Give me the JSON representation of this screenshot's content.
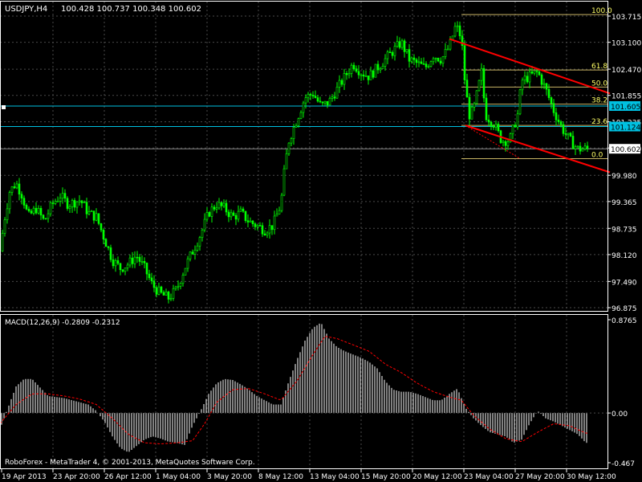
{
  "window": {
    "symbol_label": "USDJPY,H4",
    "ohlc_label": "100.428 100.737 100.348 100.602",
    "copyright": "RoboForex - MetaTrader 4, © 2001-2013, MetaQuotes Software Corp."
  },
  "colors": {
    "background": "#000000",
    "candle_bull": "#00ff00",
    "grid": "#4a4a4a",
    "axis": "#ffffff",
    "fib": "#c8b464",
    "channel": "#ff0000",
    "hline_cyan": "#00c0e0",
    "macd_hist": "#ffffff",
    "macd_signal": "#ff0000"
  },
  "price_axis": {
    "ticks": [
      "103.715",
      "103.100",
      "102.470",
      "101.855",
      "101.235",
      "100.620",
      "99.980",
      "99.365",
      "98.735",
      "98.120",
      "97.490",
      "96.875"
    ],
    "range": [
      96.875,
      103.715
    ]
  },
  "time_axis": {
    "labels": [
      "19 Apr 2013",
      "23 Apr 20:00",
      "26 Apr 12:00",
      "1 May 04:00",
      "3 May 20:00",
      "8 May 12:00",
      "13 May 04:00",
      "15 May 20:00",
      "20 May 12:00",
      "23 May 04:00",
      "27 May 20:00",
      "30 May 12:00"
    ]
  },
  "price_labels": {
    "hline_upper": "101.605",
    "hline_lower": "101.124",
    "current": "100.602"
  },
  "fibonacci": {
    "levels": [
      {
        "label": "100.0",
        "price": 103.75
      },
      {
        "label": "61.8",
        "price": 102.45
      },
      {
        "label": "50.0",
        "price": 102.05
      },
      {
        "label": "38.2",
        "price": 101.65
      },
      {
        "label": "23.6",
        "price": 101.15
      },
      {
        "label": "0.0",
        "price": 100.37
      }
    ]
  },
  "chart_data": {
    "type": "candlestick",
    "title": "USDJPY,H4",
    "price_range": [
      96.875,
      103.715
    ],
    "close_path": [
      [
        0,
        98.2
      ],
      [
        5,
        98.9
      ],
      [
        12,
        99.6
      ],
      [
        20,
        99.8
      ],
      [
        28,
        99.5
      ],
      [
        35,
        99.0
      ],
      [
        45,
        99.2
      ],
      [
        55,
        98.9
      ],
      [
        65,
        99.3
      ],
      [
        75,
        99.5
      ],
      [
        85,
        99.3
      ],
      [
        100,
        99.4
      ],
      [
        110,
        99.1
      ],
      [
        120,
        99.0
      ],
      [
        130,
        98.5
      ],
      [
        140,
        98.0
      ],
      [
        150,
        97.8
      ],
      [
        160,
        97.9
      ],
      [
        170,
        98.1
      ],
      [
        180,
        97.8
      ],
      [
        190,
        97.4
      ],
      [
        200,
        97.2
      ],
      [
        210,
        97.1
      ],
      [
        220,
        97.3
      ],
      [
        230,
        97.8
      ],
      [
        240,
        98.2
      ],
      [
        250,
        98.6
      ],
      [
        260,
        99.1
      ],
      [
        270,
        99.3
      ],
      [
        280,
        99.2
      ],
      [
        290,
        99.0
      ],
      [
        300,
        99.1
      ],
      [
        310,
        98.9
      ],
      [
        320,
        98.8
      ],
      [
        330,
        98.7
      ],
      [
        340,
        98.8
      ],
      [
        350,
        99.3
      ],
      [
        355,
        100.2
      ],
      [
        360,
        100.8
      ],
      [
        370,
        101.3
      ],
      [
        380,
        101.8
      ],
      [
        390,
        101.9
      ],
      [
        400,
        101.6
      ],
      [
        410,
        101.7
      ],
      [
        420,
        102.0
      ],
      [
        430,
        102.3
      ],
      [
        440,
        102.6
      ],
      [
        450,
        102.4
      ],
      [
        460,
        102.3
      ],
      [
        470,
        102.5
      ],
      [
        480,
        102.7
      ],
      [
        490,
        102.9
      ],
      [
        500,
        103.1
      ],
      [
        510,
        102.7
      ],
      [
        520,
        102.6
      ],
      [
        530,
        102.5
      ],
      [
        540,
        102.8
      ],
      [
        550,
        102.7
      ],
      [
        560,
        103.0
      ],
      [
        568,
        103.5
      ],
      [
        575,
        103.2
      ],
      [
        580,
        102.0
      ],
      [
        585,
        101.4
      ],
      [
        590,
        101.5
      ],
      [
        600,
        102.4
      ],
      [
        605,
        101.4
      ],
      [
        615,
        101.2
      ],
      [
        625,
        100.8
      ],
      [
        635,
        100.8
      ],
      [
        645,
        101.4
      ],
      [
        650,
        102.2
      ],
      [
        660,
        102.3
      ],
      [
        670,
        102.4
      ],
      [
        680,
        102.0
      ],
      [
        690,
        101.5
      ],
      [
        700,
        101.1
      ],
      [
        710,
        100.8
      ],
      [
        720,
        100.6
      ],
      [
        730,
        100.6
      ]
    ],
    "trend_lines": [
      {
        "from": [
          560,
          103.18
        ],
        "to": [
          760,
          101.9
        ]
      },
      {
        "from": [
          580,
          101.15
        ],
        "to": [
          760,
          100.05
        ]
      }
    ],
    "horizontal_lines": [
      101.605,
      101.124,
      100.602
    ],
    "macd": {
      "label": "MACD(12,26,9) -0.2809 -0.2312",
      "ticks": [
        "0.8765",
        "0.00",
        "-0.467"
      ],
      "range": [
        -0.467,
        0.8765
      ],
      "hist_path": [
        [
          0,
          -0.15
        ],
        [
          10,
          0.05
        ],
        [
          20,
          0.25
        ],
        [
          30,
          0.32
        ],
        [
          40,
          0.32
        ],
        [
          50,
          0.24
        ],
        [
          60,
          0.16
        ],
        [
          70,
          0.15
        ],
        [
          80,
          0.14
        ],
        [
          90,
          0.12
        ],
        [
          100,
          0.1
        ],
        [
          110,
          0.08
        ],
        [
          120,
          0.02
        ],
        [
          130,
          -0.08
        ],
        [
          140,
          -0.22
        ],
        [
          150,
          -0.33
        ],
        [
          160,
          -0.37
        ],
        [
          170,
          -0.31
        ],
        [
          180,
          -0.25
        ],
        [
          190,
          -0.22
        ],
        [
          200,
          -0.24
        ],
        [
          210,
          -0.27
        ],
        [
          220,
          -0.28
        ],
        [
          230,
          -0.3
        ],
        [
          240,
          -0.12
        ],
        [
          250,
          0.02
        ],
        [
          260,
          0.18
        ],
        [
          270,
          0.28
        ],
        [
          280,
          0.32
        ],
        [
          290,
          0.31
        ],
        [
          300,
          0.27
        ],
        [
          310,
          0.22
        ],
        [
          320,
          0.16
        ],
        [
          330,
          0.12
        ],
        [
          340,
          0.08
        ],
        [
          350,
          0.08
        ],
        [
          360,
          0.3
        ],
        [
          370,
          0.5
        ],
        [
          380,
          0.68
        ],
        [
          390,
          0.8
        ],
        [
          400,
          0.85
        ],
        [
          410,
          0.7
        ],
        [
          420,
          0.62
        ],
        [
          430,
          0.58
        ],
        [
          440,
          0.55
        ],
        [
          450,
          0.52
        ],
        [
          460,
          0.48
        ],
        [
          470,
          0.42
        ],
        [
          480,
          0.3
        ],
        [
          490,
          0.22
        ],
        [
          500,
          0.2
        ],
        [
          510,
          0.2
        ],
        [
          520,
          0.18
        ],
        [
          530,
          0.15
        ],
        [
          540,
          0.12
        ],
        [
          550,
          0.12
        ],
        [
          560,
          0.18
        ],
        [
          570,
          0.23
        ],
        [
          580,
          0.05
        ],
        [
          590,
          -0.05
        ],
        [
          600,
          -0.12
        ],
        [
          610,
          -0.18
        ],
        [
          620,
          -0.2
        ],
        [
          630,
          -0.22
        ],
        [
          640,
          -0.28
        ],
        [
          650,
          -0.25
        ],
        [
          660,
          -0.1
        ],
        [
          670,
          0.02
        ],
        [
          680,
          -0.05
        ],
        [
          690,
          -0.08
        ],
        [
          700,
          -0.12
        ],
        [
          710,
          -0.16
        ],
        [
          720,
          -0.2
        ],
        [
          730,
          -0.28
        ]
      ],
      "signal_path": [
        [
          0,
          -0.1
        ],
        [
          20,
          0.08
        ],
        [
          40,
          0.18
        ],
        [
          60,
          0.18
        ],
        [
          80,
          0.16
        ],
        [
          100,
          0.13
        ],
        [
          120,
          0.08
        ],
        [
          140,
          -0.05
        ],
        [
          160,
          -0.2
        ],
        [
          180,
          -0.28
        ],
        [
          200,
          -0.29
        ],
        [
          220,
          -0.28
        ],
        [
          240,
          -0.26
        ],
        [
          255,
          -0.1
        ],
        [
          270,
          0.1
        ],
        [
          290,
          0.22
        ],
        [
          310,
          0.23
        ],
        [
          330,
          0.18
        ],
        [
          350,
          0.12
        ],
        [
          370,
          0.3
        ],
        [
          390,
          0.55
        ],
        [
          405,
          0.72
        ],
        [
          420,
          0.7
        ],
        [
          440,
          0.64
        ],
        [
          460,
          0.58
        ],
        [
          480,
          0.46
        ],
        [
          500,
          0.38
        ],
        [
          520,
          0.28
        ],
        [
          540,
          0.2
        ],
        [
          560,
          0.15
        ],
        [
          575,
          0.12
        ],
        [
          590,
          -0.02
        ],
        [
          610,
          -0.15
        ],
        [
          630,
          -0.24
        ],
        [
          650,
          -0.27
        ],
        [
          670,
          -0.18
        ],
        [
          690,
          -0.1
        ],
        [
          710,
          -0.12
        ],
        [
          730,
          -0.19
        ]
      ]
    }
  }
}
